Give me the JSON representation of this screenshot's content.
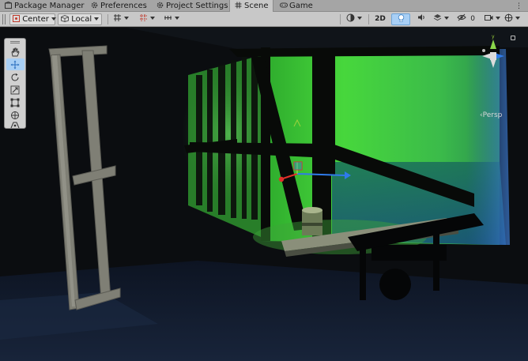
{
  "tabs": [
    {
      "label": "Package Manager",
      "icon": "package-icon",
      "active": false
    },
    {
      "label": "Preferences",
      "icon": "gear-icon",
      "active": false
    },
    {
      "label": "Project Settings",
      "icon": "gear-icon",
      "active": false
    },
    {
      "label": "Scene",
      "icon": "grid-icon",
      "active": true
    },
    {
      "label": "Game",
      "icon": "gamepad-icon",
      "active": false
    }
  ],
  "toolbar": {
    "pivot_label": "Center",
    "space_label": "Local",
    "mode_2d_label": "2D"
  },
  "gizmo": {
    "projection_label": "‹Persp"
  },
  "colors": {
    "tab_bar": "#a5a5a5",
    "toolbar": "#c8c8c8",
    "active_toggle": "#a8cff5",
    "scene_green": "#3fdc3a",
    "axis_x": "#e0302a",
    "axis_y": "#8ad64a",
    "axis_z": "#2f7bea"
  }
}
